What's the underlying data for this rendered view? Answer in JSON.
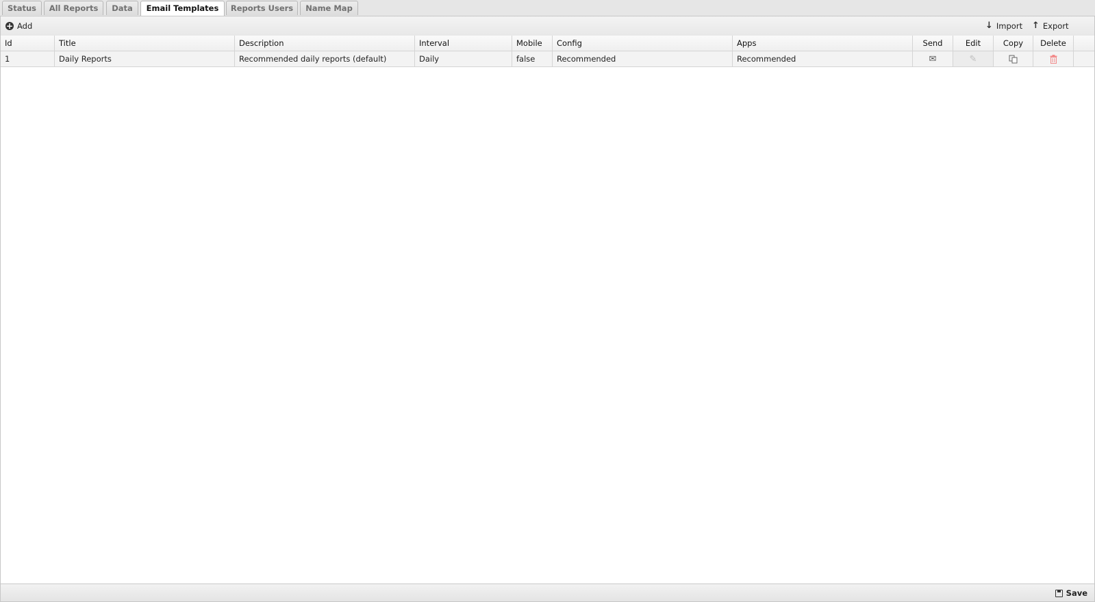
{
  "tabs": [
    {
      "label": "Status",
      "active": false
    },
    {
      "label": "All Reports",
      "active": false
    },
    {
      "label": "Data",
      "active": false
    },
    {
      "label": "Email Templates",
      "active": true
    },
    {
      "label": "Reports Users",
      "active": false
    },
    {
      "label": "Name Map",
      "active": false
    }
  ],
  "toolbar": {
    "add_label": "Add",
    "import_label": "Import",
    "export_label": "Export"
  },
  "grid": {
    "columns": [
      "Id",
      "Title",
      "Description",
      "Interval",
      "Mobile",
      "Config",
      "Apps",
      "Send",
      "Edit",
      "Copy",
      "Delete"
    ],
    "rows": [
      {
        "id": "1",
        "title": "Daily Reports",
        "description": "Recommended daily reports (default)",
        "interval": "Daily",
        "mobile": "false",
        "config": "Recommended",
        "apps": "Recommended"
      }
    ]
  },
  "footer": {
    "save_label": "Save"
  },
  "colors": {
    "delete_icon": "#f28b8b",
    "edit_icon": "#bdbdbd"
  }
}
